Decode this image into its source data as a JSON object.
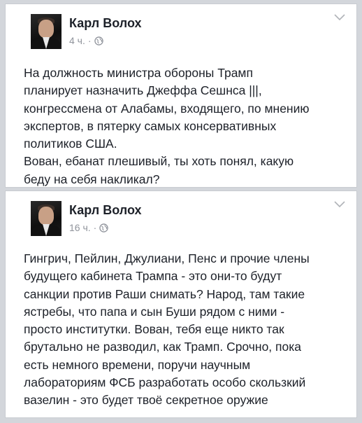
{
  "posts": [
    {
      "author": "Карл Волох",
      "time": "4 ч.",
      "separator": "·",
      "lines": [
        "На должность министра обороны Трамп",
        "планирует назначить Джеффа Сешнса |||,",
        "конгрессмена от Алабамы, входящего, по мнению",
        "экспертов, в пятерку самых консервативных",
        "политиков США.",
        "Вован, ебанат плешивый, ты хоть понял, какую",
        "беду на себя накликал?"
      ]
    },
    {
      "author": "Карл Волох",
      "time": "16 ч.",
      "separator": "·",
      "lines": [
        "Гингрич, Пейлин, Джулиани, Пенс и прочие члены",
        "будущего кабинета Трампа - это они-то будут",
        "санкции против Раши снимать? Народ, там такие",
        "ястребы, что папа и сын Буши рядом с ними -",
        "просто институтки. Вован, тебя еще никто так",
        "брутально не разводил, как Трамп. Срочно, пока",
        "есть немного времени, поручи научным",
        "лабораториям ФСБ разработать особо скользкий",
        "вазелин - это будет твоё секретное оружие"
      ]
    }
  ],
  "icons": {
    "privacy": "globe-icon",
    "menu": "chevron-down-icon"
  }
}
